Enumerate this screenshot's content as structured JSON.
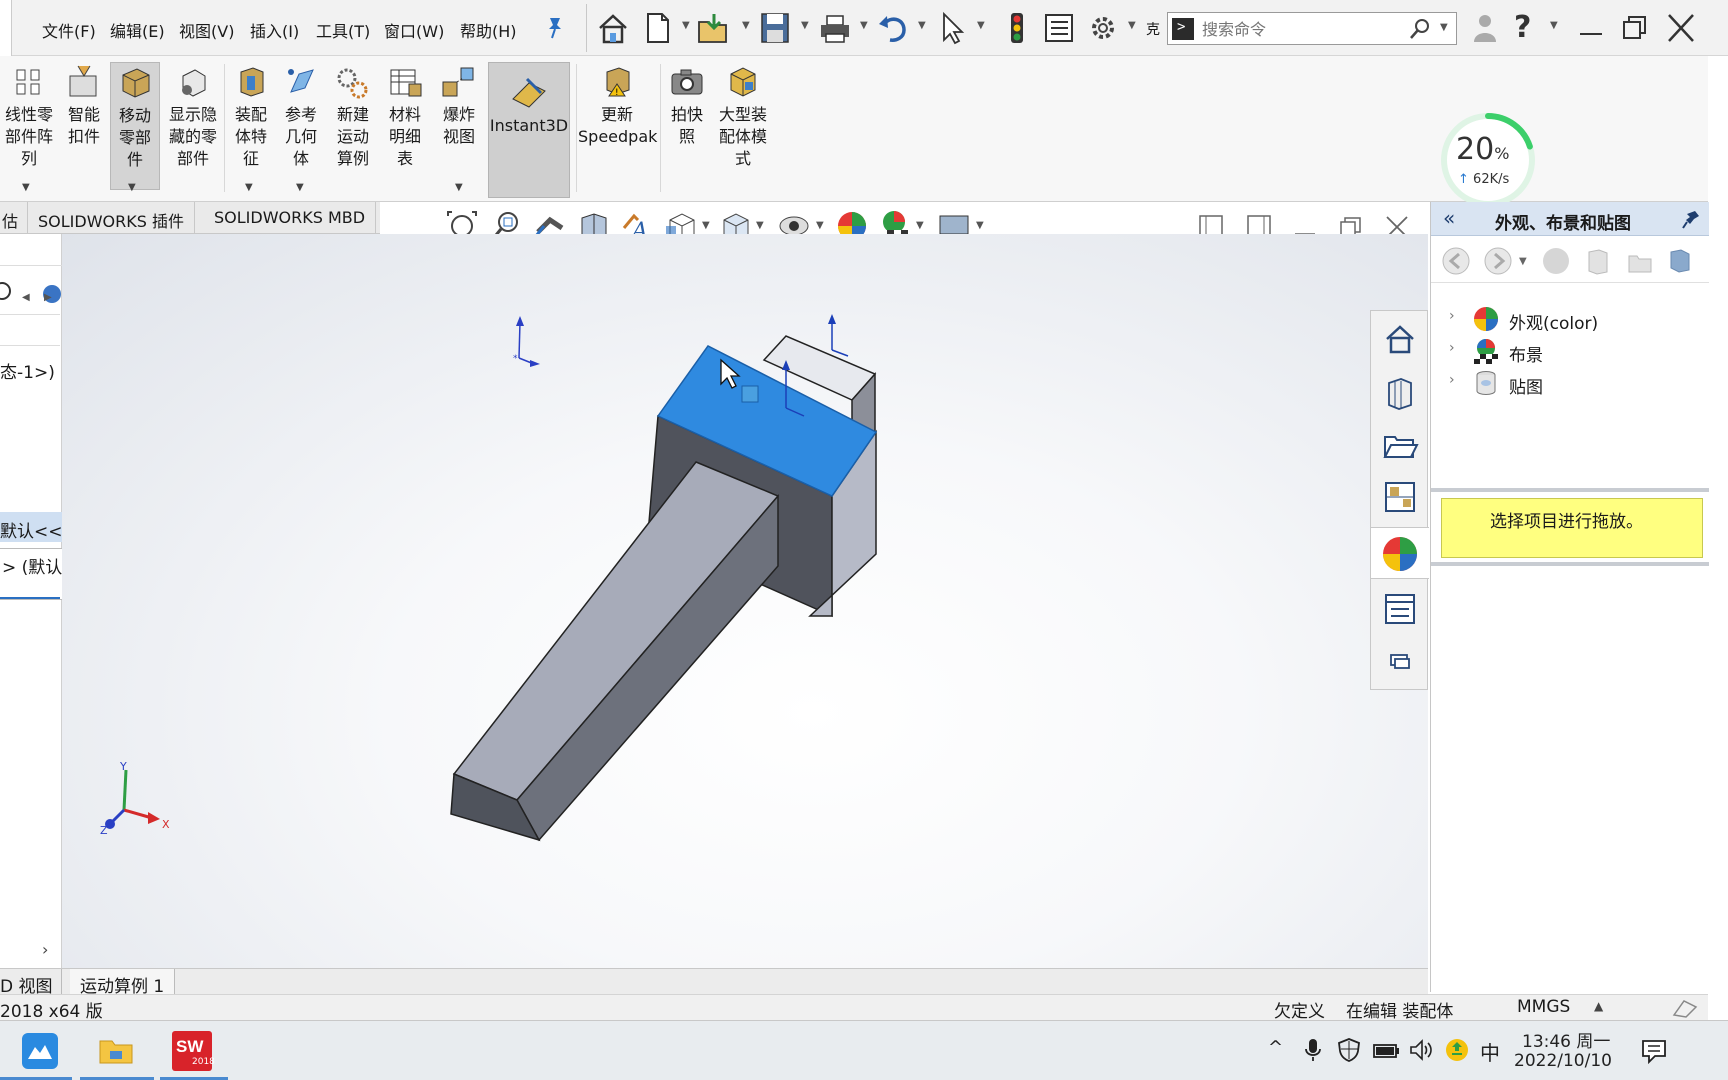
{
  "menu": {
    "items": [
      "文件(F)",
      "编辑(E)",
      "视图(V)",
      "插入(I)",
      "工具(T)",
      "窗口(W)",
      "帮助(H)"
    ]
  },
  "toolbar": {
    "search_placeholder": "搜索命令",
    "truncated_label": "克"
  },
  "ribbon": {
    "buttons": [
      {
        "label": "线性零\n部件阵\n列",
        "icon": "linear-pattern-icon"
      },
      {
        "label": "智能\n扣件",
        "icon": "smart-fastener-icon"
      },
      {
        "label": "移动\n零部\n件",
        "icon": "move-component-icon"
      },
      {
        "label": "显示隐\n藏的零\n部件",
        "icon": "show-hidden-icon"
      },
      {
        "label": "装配\n体特\n征",
        "icon": "assembly-feature-icon"
      },
      {
        "label": "参考\n几何\n体",
        "icon": "reference-geometry-icon"
      },
      {
        "label": "新建\n运动\n算例",
        "icon": "motion-study-icon"
      },
      {
        "label": "材料\n明细\n表",
        "icon": "bom-icon"
      },
      {
        "label": "爆炸\n视图",
        "icon": "explode-view-icon"
      },
      {
        "label": "Instant3D",
        "icon": "instant3d-icon"
      },
      {
        "label": "更新\nSpeedpak",
        "icon": "speedpak-icon"
      },
      {
        "label": "拍快\n照",
        "icon": "snapshot-icon"
      },
      {
        "label": "大型装\n配体模\n式",
        "icon": "large-assembly-icon"
      }
    ]
  },
  "network_widget": {
    "percent": "20",
    "percent_sign": "%",
    "speed": "62K/s",
    "progress": 0.2
  },
  "tabs": {
    "items": [
      "估",
      "SOLIDWORKS 插件",
      "SOLIDWORKS MBD"
    ]
  },
  "left_panel": {
    "config_text": "态-1>)",
    "default_label": "默认<<",
    "default_sub": "> (默认"
  },
  "taskpane": {
    "title": "外观、布景和贴图",
    "tree": [
      {
        "label": "外观(color)",
        "icon": "appearance-icon"
      },
      {
        "label": "布景",
        "icon": "scene-icon"
      },
      {
        "label": "贴图",
        "icon": "decal-icon"
      }
    ],
    "hint": "选择项目进行拖放。"
  },
  "bottom_tabs": {
    "items": [
      "D 视图",
      "运动算例 1"
    ]
  },
  "statusbar": {
    "version": "2018 x64 版",
    "state1": "欠定义",
    "state2": "在编辑 装配体",
    "units": "MMGS"
  },
  "taskbar": {
    "ime": "中",
    "time": "13:46 周一",
    "date": "2022/10/10",
    "sw_label": "SW",
    "sw_year": "2018"
  },
  "axes": {
    "x": "X",
    "y": "Y",
    "z": "Z"
  },
  "colors": {
    "selection_blue": "#2f8ae0",
    "hint_yellow": "#ffff80",
    "progress_green": "#3ccf6a"
  }
}
